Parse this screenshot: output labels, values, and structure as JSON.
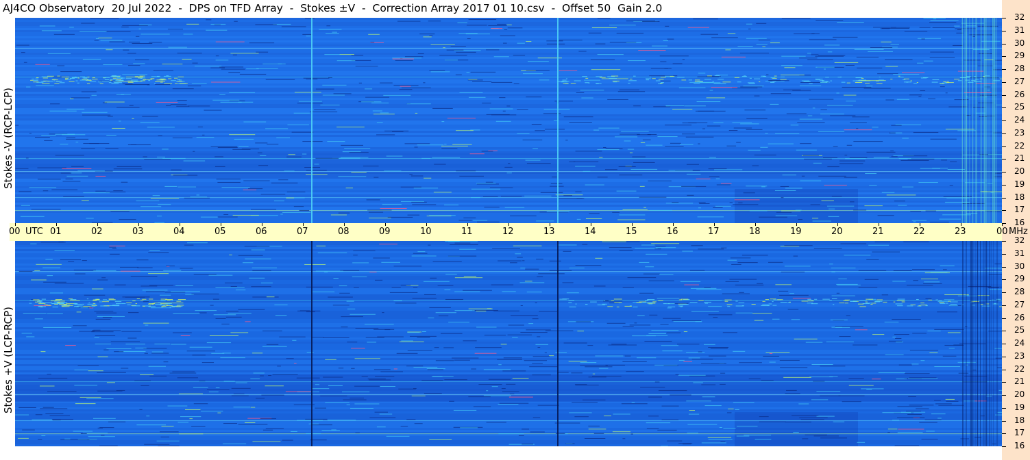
{
  "header": {
    "title": "AJ4CO Observatory  20 Jul 2022  -  DPS on TFD Array  -  Stokes ±V  -  Correction Array 2017 01 10.csv  -  Offset 50  Gain 2.0"
  },
  "panels": {
    "top_label": "Stokes -V (RCP-LCP)",
    "bottom_label": "Stokes +V (LCP-RCP)"
  },
  "colors": {
    "background_blue": "#1e6fe6",
    "dark_blue": "#0d3aa8",
    "light_blue": "#2fb4ee",
    "time_strip": "#ffffc6",
    "freq_strip": "#fde3c9"
  },
  "chart_data": {
    "type": "heatmap",
    "x_unit": "UTC",
    "y_unit": "MHz",
    "x_range": [
      "00",
      "00"
    ],
    "y_range": [
      16,
      32
    ],
    "time_ticks": [
      "00",
      "01",
      "02",
      "03",
      "04",
      "05",
      "06",
      "07",
      "08",
      "09",
      "10",
      "11",
      "12",
      "13",
      "14",
      "15",
      "16",
      "17",
      "18",
      "19",
      "20",
      "21",
      "22",
      "23",
      "00"
    ],
    "utc_label": "UTC",
    "mhz_label": "MHz",
    "freq_ticks": [
      "32",
      "31",
      "30",
      "29",
      "28",
      "27",
      "26",
      "25",
      "24",
      "23",
      "22",
      "21",
      "20",
      "19",
      "18",
      "17",
      "16"
    ],
    "series": [
      {
        "name": "Stokes -V (RCP-LCP)"
      },
      {
        "name": "Stokes +V (LCP-RCP)"
      }
    ]
  }
}
